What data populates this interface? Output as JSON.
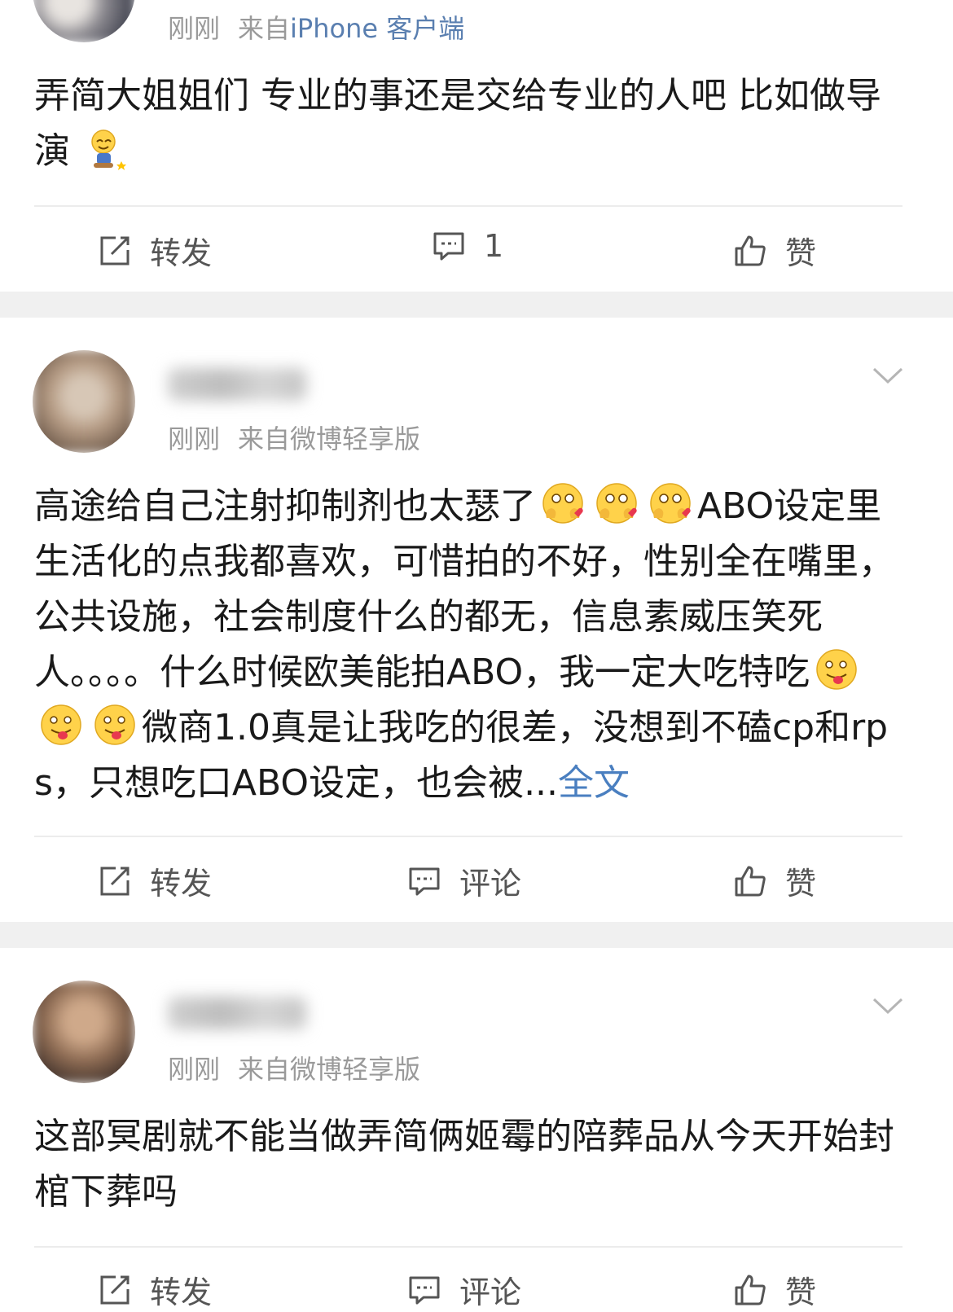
{
  "posts": [
    {
      "meta_time": "刚刚",
      "meta_source_prefix": "来自",
      "meta_source": "iPhone 客户端",
      "content": "弄简大姐姐们 专业的事还是交给专业的人吧  比如做导演",
      "actions": {
        "repost": "转发",
        "comment": "1",
        "like": "赞"
      }
    },
    {
      "meta_time": "刚刚",
      "meta_source": "来自微博轻享版",
      "content_parts": [
        "高途给自己注射抑制剂也太瑟了",
        "ABO设定里生活化的点我都喜欢，可惜拍的不好，性别全在嘴里，公共设施，社会制度什么的都无，信息素威压笑死人。。。。什么时候欧美能拍ABO，我一定大吃特吃",
        "微商1.0真是让我吃的很差，没想到不磕cp和rps，只想吃口ABO设定，也会被..."
      ],
      "more_link": "全文",
      "actions": {
        "repost": "转发",
        "comment": "评论",
        "like": "赞"
      }
    },
    {
      "meta_time": "刚刚",
      "meta_source": "来自微博轻享版",
      "content": "这部冥剧就不能当做弄简俩姬霉的陪葬品从今天开始封棺下葬吗",
      "actions": {
        "repost": "转发",
        "comment": "评论",
        "like": "赞"
      }
    }
  ],
  "icons": {
    "repost": "repost-icon",
    "comment": "comment-icon",
    "like": "thumbs-up-icon",
    "menu": "chevron-down-icon",
    "emoji_1": "sweat-smile-emoji",
    "emoji_2": "heart-eyes-hands-emoji",
    "emoji_3": "tongue-out-emoji"
  },
  "colors": {
    "link": "#4a7fc0",
    "meta": "#9a9a9a",
    "separator": "#f0f0f0"
  }
}
